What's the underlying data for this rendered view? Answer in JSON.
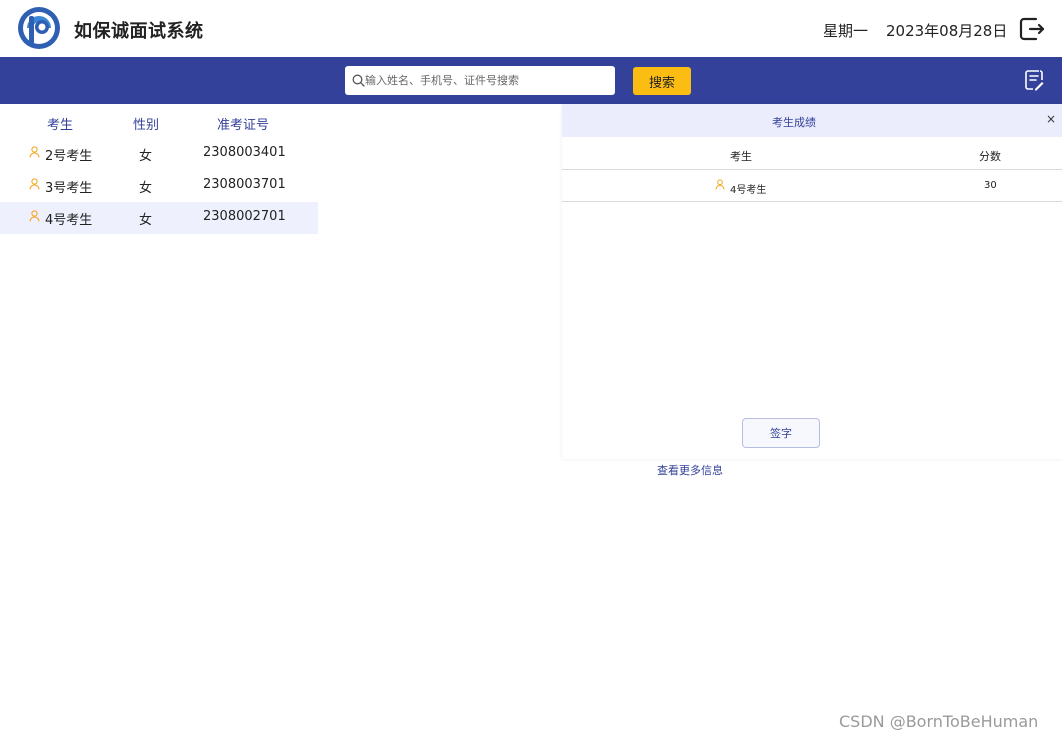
{
  "header": {
    "app_title": "如保诚面试系统",
    "weekday": "星期一",
    "date": "2023年08月28日"
  },
  "toolbar": {
    "search_placeholder": "输入姓名、手机号、证件号搜索",
    "search_button": "搜索"
  },
  "candidate_list": {
    "columns": [
      "考生",
      "性别",
      "准考证号"
    ],
    "rows": [
      {
        "name": "2号考生",
        "gender": "女",
        "exam_no": "2308003401",
        "selected": false
      },
      {
        "name": "3号考生",
        "gender": "女",
        "exam_no": "2308003701",
        "selected": false
      },
      {
        "name": "4号考生",
        "gender": "女",
        "exam_no": "2308002701",
        "selected": true
      }
    ]
  },
  "score_panel": {
    "title": "考生成绩",
    "close": "×",
    "columns": [
      "考生",
      "分数"
    ],
    "rows": [
      {
        "name": "4号考生",
        "score": "30"
      }
    ],
    "sign_button": "签字",
    "more_link": "查看更多信息"
  },
  "watermark": "CSDN @BornToBeHuman",
  "colors": {
    "primary": "#33419a",
    "accent": "#fbbd12",
    "selected_row": "#eef1fd",
    "panel_title_bg": "#ebedfc",
    "person_icon": "#f5a623"
  },
  "icons": {
    "logo": "logo-icon",
    "logout": "logout-icon",
    "search": "search-icon",
    "record": "edit-record-icon",
    "person": "person-icon"
  }
}
